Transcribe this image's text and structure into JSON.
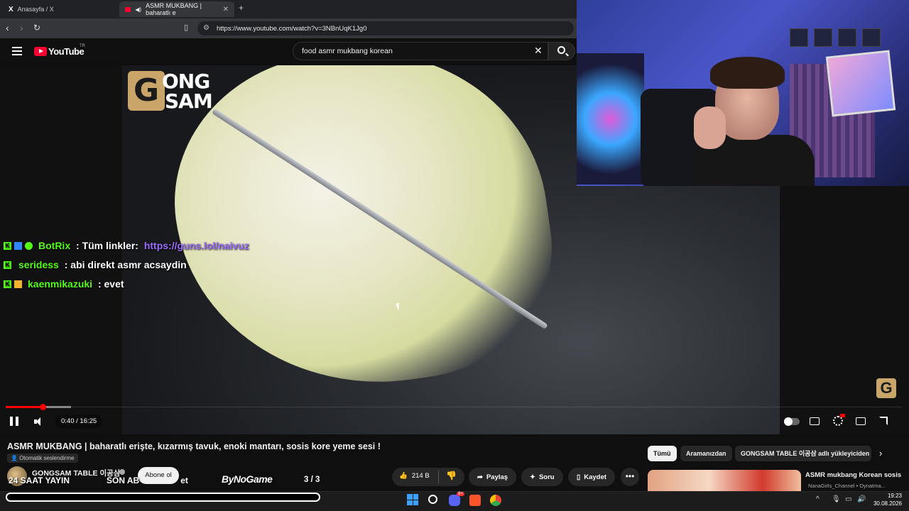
{
  "browser": {
    "tabs": [
      {
        "label": "Anasayfa / X",
        "icon": "x-logo-icon"
      },
      {
        "label": "ASMR MUKBANG | baharatlı e",
        "icon": "youtube-icon",
        "close": "✕"
      }
    ],
    "new_tab": "+",
    "url": "https://www.youtube.com/watch?v=3NBnUqK1Jg0"
  },
  "youtube": {
    "logo_text": "YouTube",
    "region": "TR",
    "search_query": "food asmr mukbang korean"
  },
  "video": {
    "watermark_top": "ONG",
    "watermark_bottom": "SAM",
    "watermark_g": "G",
    "corner_logo": "G",
    "time": "0:40 / 16:25",
    "progress": 0.041
  },
  "chat": [
    {
      "user": "BotRix",
      "sep": " : ",
      "text": "Tüm linkler: ",
      "link": "https://guns.lol/naivuz"
    },
    {
      "user": "seridess",
      "sep": " : ",
      "text": "abi direkt asmr acsaydin",
      "link": ""
    },
    {
      "user": "kaenmikazuki",
      "sep": " : ",
      "text": "evet",
      "link": ""
    }
  ],
  "below": {
    "title": "ASMR MUKBANG | baharatlı erişte, kızarmış tavuk, enoki mantarı, sosis kore yeme sesi !",
    "auto_dub": "Otomatik seslendirme",
    "channel": "GONGSAM TABLE 이공삼",
    "subscribe": "Abone ol",
    "likes": "214 B",
    "share": "Paylaş",
    "ask": "Soru",
    "save": "Kaydet",
    "more": "•••"
  },
  "chips": [
    "Tümü",
    "Aramanızdan",
    "GONGSAM TABLE 이공삼 adlı yükleyiciden"
  ],
  "related": {
    "title": "ASMR mukbang Korean sosis",
    "channel": "NanaGirls_Channel • Oynatma..."
  },
  "stream_banner": {
    "live": "24 SAAT YAYIN",
    "last": "SON AB",
    "last_tail": "et",
    "brand": "ByNoGame",
    "count": "3 / 3"
  },
  "taskbar": {
    "time": "19:23",
    "date": "30.08.2026",
    "discord_badge": "9+"
  },
  "colors": {
    "youtube_red": "#ff0000",
    "kick_green": "#53fc18",
    "link_purple": "#9b6cff"
  }
}
